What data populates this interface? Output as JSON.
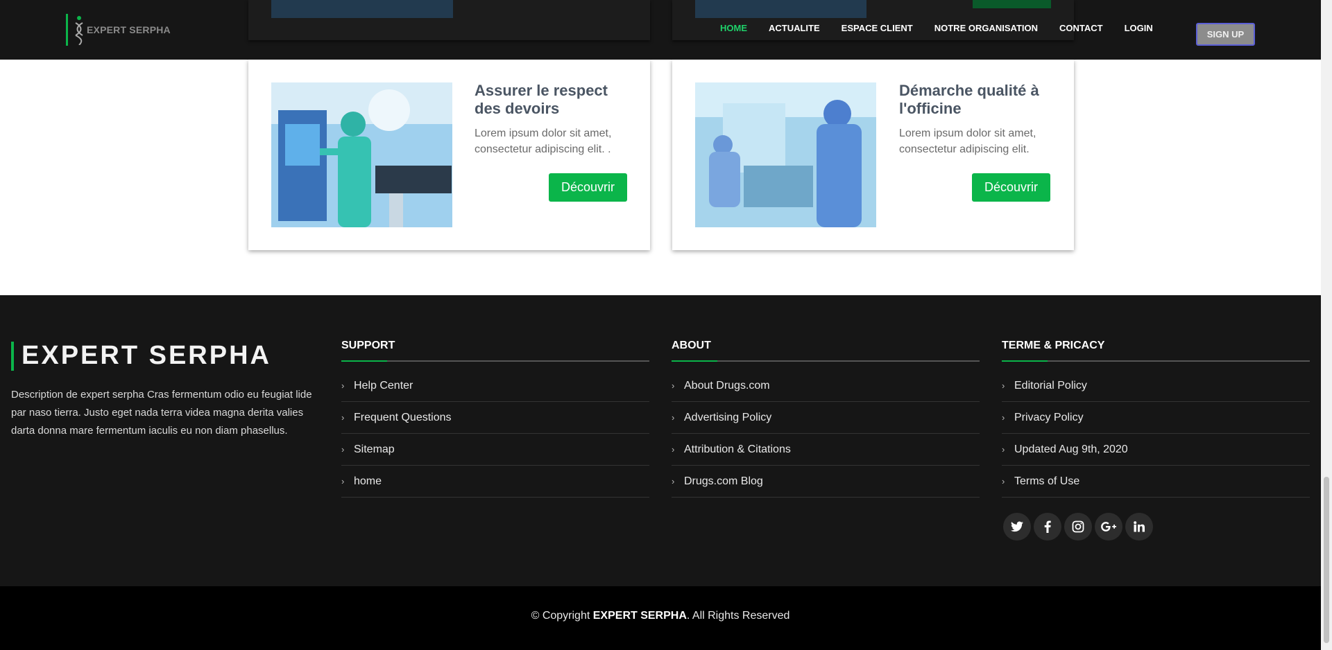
{
  "colors": {
    "accent": "#0bb54a",
    "nav_active": "#1fd16a",
    "dark": "#161616"
  },
  "nav": {
    "logo_name": "EXPERT SERPHA",
    "items": [
      "HOME",
      "ACTUALITE",
      "ESPACE CLIENT",
      "NOTRE ORGANISATION",
      "CONTACT",
      "LOGIN"
    ],
    "signup": "SIGN UP"
  },
  "cards": [
    {
      "title": "Assurer le respect des devoirs",
      "text": "Lorem ipsum dolor sit amet, consectetur adipiscing elit. .",
      "button": "Découvrir"
    },
    {
      "title": "Démarche qualité à l'officine",
      "text": "Lorem ipsum dolor sit amet, consectetur adipiscing elit.",
      "button": "Découvrir"
    }
  ],
  "footer": {
    "brand": "EXPERT SERPHA",
    "description": "Description de expert serpha Cras fermentum odio eu feugiat lide par naso tierra. Justo eget nada terra videa magna derita valies darta donna mare fermentum iaculis eu non diam phasellus.",
    "columns": [
      {
        "heading": "SUPPORT",
        "links": [
          "Help Center",
          "Frequent Questions",
          "Sitemap",
          "home"
        ]
      },
      {
        "heading": "ABOUT",
        "links": [
          "About Drugs.com",
          "Advertising Policy",
          "Attribution & Citations",
          "Drugs.com Blog"
        ]
      },
      {
        "heading": "TERME & PRICACY",
        "links": [
          "Editorial Policy",
          "Privacy Policy",
          "Updated Aug 9th, 2020",
          "Terms of Use"
        ]
      }
    ],
    "socials": [
      "twitter-icon",
      "facebook-icon",
      "instagram-icon",
      "google-plus-icon",
      "linkedin-icon"
    ],
    "copyright_prefix": "© Copyright",
    "copyright_brand": "EXPERT SERPHA",
    "copyright_suffix": ". All Rights Reserved"
  }
}
